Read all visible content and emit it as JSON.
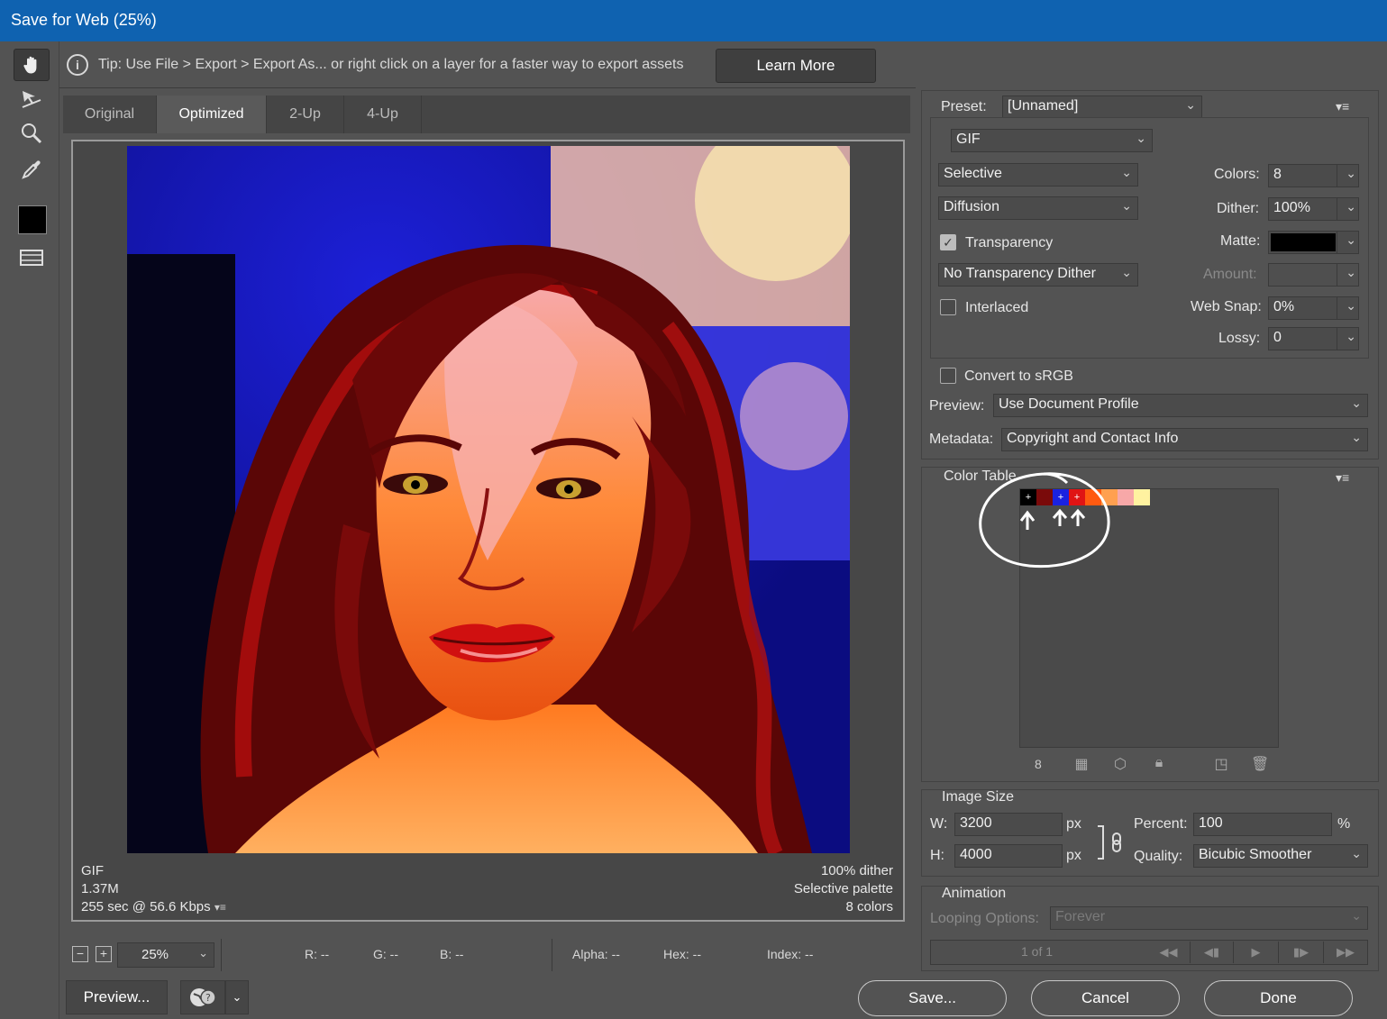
{
  "window": {
    "title": "Save for Web (25%)"
  },
  "tools": {
    "hand": "hand-icon",
    "slice_select": "slice-select-icon",
    "zoom": "zoom-icon",
    "eyedropper": "eyedropper-icon",
    "eyedropper_color": "#000000",
    "toggle_slices": "toggle-slices-icon"
  },
  "tip": {
    "text": "Tip: Use File > Export > Export As...  or right click on a layer for a faster way to export assets",
    "learn_more": "Learn More"
  },
  "tabs": [
    "Original",
    "Optimized",
    "2-Up",
    "4-Up"
  ],
  "active_tab": "Optimized",
  "image_info": {
    "format": "GIF",
    "size": "1.37M",
    "time": "255 sec @ 56.6 Kbps",
    "dither": "100% dither",
    "palette": "Selective palette",
    "colors": "8 colors"
  },
  "status": {
    "zoom": "25%",
    "r": "R: --",
    "g": "G: --",
    "b": "B: --",
    "alpha": "Alpha: --",
    "hex": "Hex: --",
    "index": "Index: --"
  },
  "buttons": {
    "preview": "Preview...",
    "save": "Save...",
    "cancel": "Cancel",
    "done": "Done"
  },
  "settings": {
    "preset_label": "Preset:",
    "preset": "[Unnamed]",
    "format": "GIF",
    "reduction": "Selective",
    "dither_algo": "Diffusion",
    "transparency_label": "Transparency",
    "transparency_checked": true,
    "transparency_dither": "No Transparency Dither",
    "interlaced_label": "Interlaced",
    "interlaced_checked": false,
    "colors_label": "Colors:",
    "colors": "8",
    "dither_label": "Dither:",
    "dither": "100%",
    "matte_label": "Matte:",
    "matte_color": "#000000",
    "amount_label": "Amount:",
    "websnap_label": "Web Snap:",
    "websnap": "0%",
    "lossy_label": "Lossy:",
    "lossy": "0",
    "convert_label": "Convert to sRGB",
    "convert_checked": false,
    "preview_label": "Preview:",
    "preview_value": "Use Document Profile",
    "metadata_label": "Metadata:",
    "metadata_value": "Copyright and Contact Info"
  },
  "color_table": {
    "title": "Color Table",
    "count": "8",
    "swatches": [
      {
        "color": "#000000",
        "mark": "+"
      },
      {
        "color": "#7a0a0a",
        "mark": ""
      },
      {
        "color": "#1a22e0",
        "mark": "+"
      },
      {
        "color": "#e01414",
        "mark": "+"
      },
      {
        "color": "#ff5a10",
        "mark": ""
      },
      {
        "color": "#ffa050",
        "mark": ""
      },
      {
        "color": "#f7a8a8",
        "mark": ""
      },
      {
        "color": "#fff2a0",
        "mark": ""
      }
    ]
  },
  "image_size": {
    "title": "Image Size",
    "w_label": "W:",
    "w": "3200",
    "h_label": "H:",
    "h": "4000",
    "unit": "px",
    "percent_label": "Percent:",
    "percent": "100",
    "percent_unit": "%",
    "quality_label": "Quality:",
    "quality": "Bicubic Smoother"
  },
  "animation": {
    "title": "Animation",
    "looping_label": "Looping Options:",
    "looping": "Forever",
    "frame": "1 of 1"
  }
}
